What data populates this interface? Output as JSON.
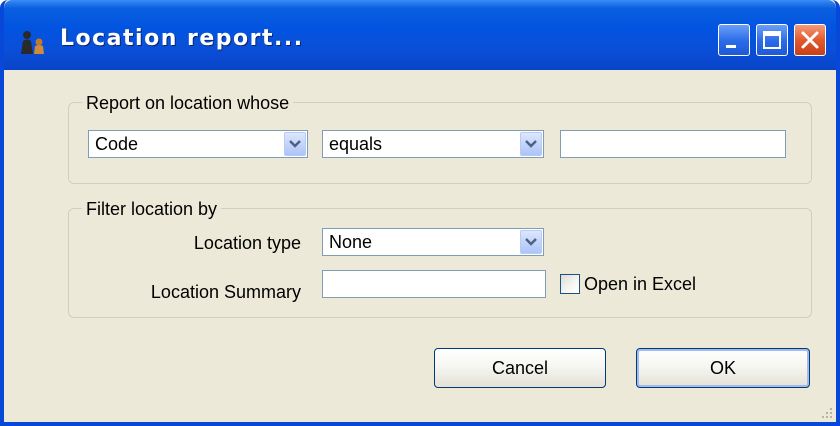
{
  "window": {
    "title": "Location report...",
    "icon": "app-icon",
    "controls": {
      "minimize_icon": "minimize-icon",
      "maximize_icon": "maximize-icon",
      "close_icon": "close-icon"
    }
  },
  "report_group": {
    "legend": "Report on location whose",
    "field_select": {
      "selected": "Code"
    },
    "operator_select": {
      "selected": "equals"
    },
    "criteria_input": {
      "value": "",
      "placeholder": ""
    }
  },
  "filter_group": {
    "legend": "Filter location by",
    "location_type": {
      "label": "Location type",
      "selected": "None"
    },
    "location_summary": {
      "label": "Location Summary",
      "value": "",
      "placeholder": ""
    },
    "open_in_excel": {
      "label": "Open in Excel",
      "checked": false
    }
  },
  "buttons": {
    "cancel": "Cancel",
    "ok": "OK"
  },
  "colors": {
    "titlebar": "#0254e0",
    "dialog_background": "#ece9d8",
    "close_button": "#e25a2c"
  }
}
